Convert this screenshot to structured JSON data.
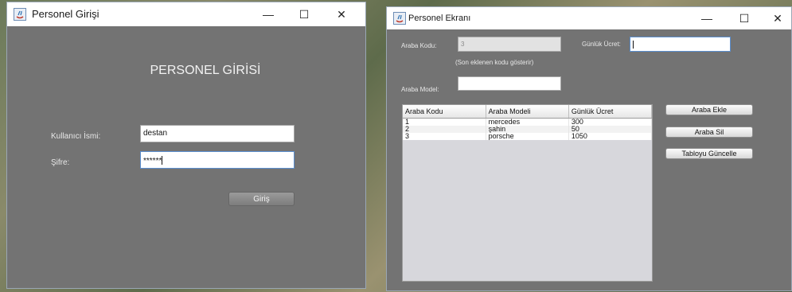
{
  "login_window": {
    "title": "Personel Girişi",
    "heading": "PERSONEL GİRİSİ",
    "username_label": "Kullanıcı İsmi:",
    "username_value": "destan",
    "password_label": "Şifre:",
    "password_value": "******",
    "login_button": "Giriş",
    "controls": {
      "minimize": "—",
      "maximize": "☐",
      "close": "✕"
    }
  },
  "staff_window": {
    "title": "Personel Ekranı",
    "car_code_label": "Araba Kodu:",
    "car_code_value": "3",
    "car_code_hint": "(Son eklenen kodu gösterir)",
    "daily_fee_label": "Günlük Ücret:",
    "daily_fee_value": "",
    "car_model_label": "Araba Model:",
    "car_model_value": "",
    "table": {
      "columns": [
        "Araba Kodu",
        "Araba Modeli",
        "Günlük Ücret"
      ],
      "rows": [
        [
          "1",
          "mercedes",
          "300"
        ],
        [
          "2",
          "şahin",
          "50"
        ],
        [
          "3",
          "porsche",
          "1050"
        ]
      ]
    },
    "buttons": {
      "add": "Araba Ekle",
      "delete": "Araba Sil",
      "refresh": "Tabloyu Güncelle"
    },
    "controls": {
      "minimize": "—",
      "maximize": "☐",
      "close": "✕"
    }
  }
}
